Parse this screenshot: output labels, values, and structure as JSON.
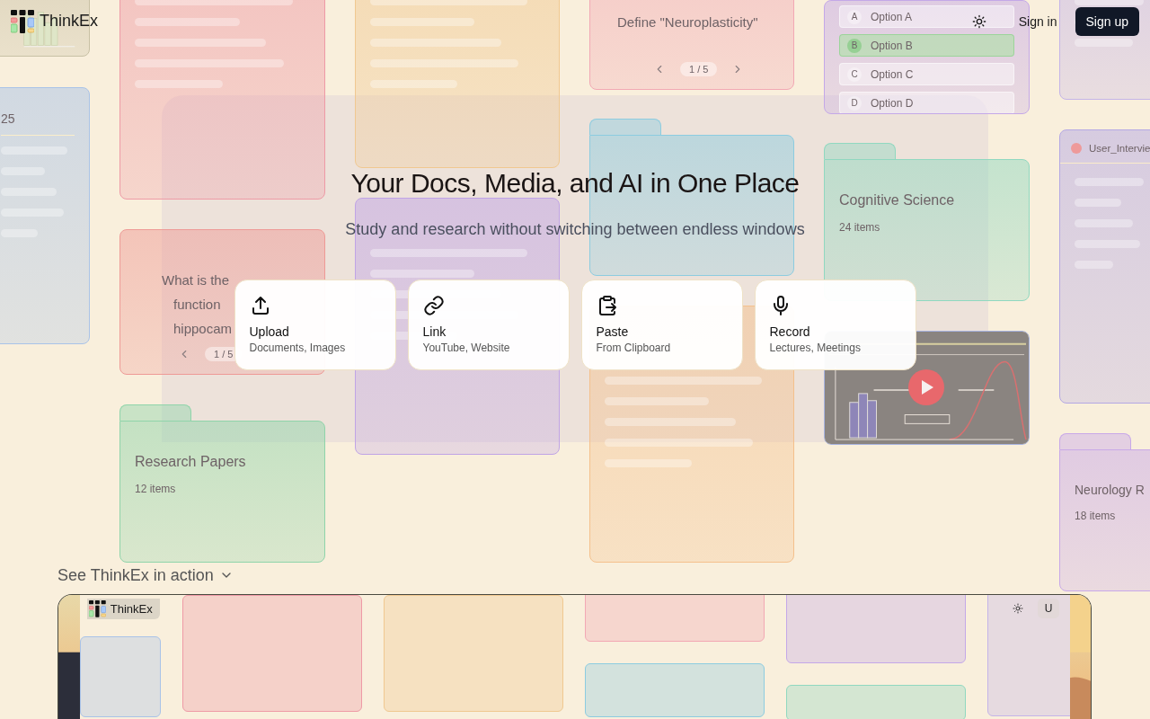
{
  "nav": {
    "brand": "ThinkEx",
    "sign_in": "Sign in",
    "sign_up": "Sign up"
  },
  "background_cards": [
    {
      "kind": "chart"
    },
    {
      "kind": "document",
      "title": "25"
    },
    {
      "kind": "document"
    },
    {
      "kind": "flashcard",
      "lines": [
        "What is the",
        "function",
        "hippocam"
      ],
      "counter": "1 / 5"
    },
    {
      "kind": "folder",
      "title": "Research Papers",
      "count": "12 items"
    },
    {
      "kind": "document"
    },
    {
      "kind": "document"
    },
    {
      "kind": "flashcard",
      "lines": [
        "Define \"Neuroplasticity\""
      ],
      "counter": "1 / 5"
    },
    {
      "kind": "folder"
    },
    {
      "kind": "document"
    },
    {
      "kind": "quiz",
      "options": [
        {
          "letter": "A",
          "label": "Option A",
          "selected": false
        },
        {
          "letter": "B",
          "label": "Option B",
          "selected": true
        },
        {
          "letter": "C",
          "label": "Option C",
          "selected": false
        },
        {
          "letter": "D",
          "label": "Option D",
          "selected": false
        }
      ]
    },
    {
      "kind": "folder",
      "title": "Cognitive Science",
      "count": "24 items"
    },
    {
      "kind": "video"
    },
    {
      "kind": "document"
    },
    {
      "kind": "transcript",
      "title": "User_Intervie"
    },
    {
      "kind": "folder",
      "title": "Neurology R",
      "count": "18 items"
    }
  ],
  "hero": {
    "title": "Your Docs, Media, and AI in One Place",
    "subtitle": "Study and research without switching between endless windows",
    "actions": [
      {
        "kind": "upload",
        "label": "Upload",
        "hint": "Documents, Images"
      },
      {
        "kind": "link",
        "label": "Link",
        "hint": "YouTube, Website"
      },
      {
        "kind": "paste",
        "label": "Paste",
        "hint": "From Clipboard"
      },
      {
        "kind": "record",
        "label": "Record",
        "hint": "Lectures, Meetings"
      }
    ]
  },
  "demo": {
    "toggle": "See ThinkEx in action",
    "preview": {
      "brand": "ThinkEx",
      "avatar": "U"
    }
  }
}
